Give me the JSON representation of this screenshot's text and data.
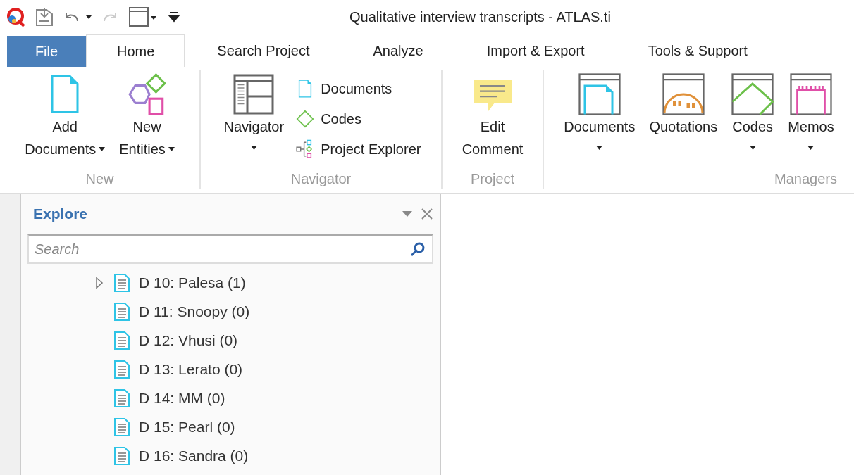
{
  "window": {
    "title": "Qualitative interview transcripts - ATLAS.ti"
  },
  "file_tab": "File",
  "tabs": [
    {
      "label": "Home",
      "selected": true
    },
    {
      "label": "Search Project",
      "selected": false
    },
    {
      "label": "Analyze",
      "selected": false
    },
    {
      "label": "Import & Export",
      "selected": false
    },
    {
      "label": "Tools & Support",
      "selected": false
    }
  ],
  "ribbon": {
    "groups": [
      {
        "label": "New",
        "kind": "new",
        "buttons": [
          {
            "lines": [
              "Add",
              "Documents"
            ],
            "dropdown": true
          },
          {
            "lines": [
              "New",
              "Entities"
            ],
            "dropdown": true
          }
        ]
      },
      {
        "label": "Navigator",
        "kind": "navigator",
        "buttons": [
          {
            "lines": [
              "Navigator"
            ],
            "dropdown": true
          }
        ],
        "small_buttons": [
          {
            "label": "Documents"
          },
          {
            "label": "Codes"
          },
          {
            "label": "Project Explorer"
          }
        ]
      },
      {
        "label": "Project",
        "kind": "project",
        "buttons": [
          {
            "lines": [
              "Edit",
              "Comment"
            ],
            "dropdown": false
          }
        ]
      },
      {
        "label": "Managers",
        "kind": "managers",
        "buttons": [
          {
            "lines": [
              "Documents"
            ],
            "dropdown": true
          },
          {
            "lines": [
              "Quotations"
            ],
            "dropdown": false
          },
          {
            "lines": [
              "Codes"
            ],
            "dropdown": true
          },
          {
            "lines": [
              "Memos"
            ],
            "dropdown": true
          }
        ]
      }
    ]
  },
  "explore": {
    "title": "Explore",
    "search": {
      "placeholder": "Search"
    },
    "items": [
      {
        "label": "D 10: Palesa (1)",
        "expandable": true
      },
      {
        "label": "D 11: Snoopy (0)",
        "expandable": false
      },
      {
        "label": "D 12: Vhusi (0)",
        "expandable": false
      },
      {
        "label": "D 13: Lerato (0)",
        "expandable": false
      },
      {
        "label": "D 14: MM (0)",
        "expandable": false
      },
      {
        "label": "D 15: Pearl (0)",
        "expandable": false
      },
      {
        "label": "D 16: Sandra (0)",
        "expandable": false
      }
    ]
  }
}
